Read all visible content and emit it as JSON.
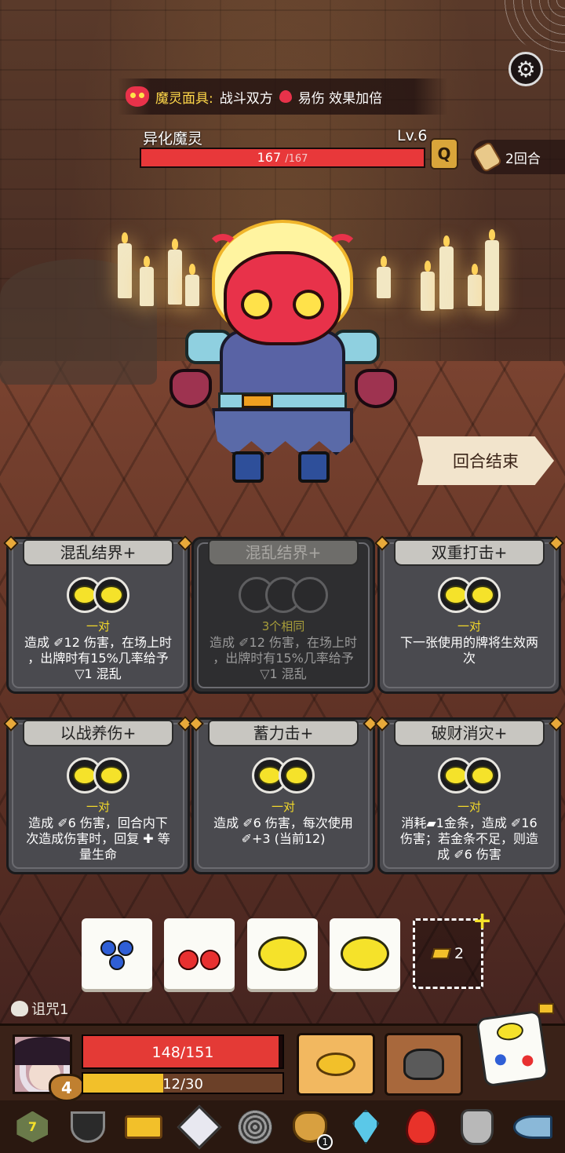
{
  "top": {
    "mask_label": "魔灵面具:",
    "mask_effect_a": "战斗双方",
    "mask_effect_b": "易伤 效果加倍"
  },
  "enemy": {
    "name": "异化魔灵",
    "level": "Lv.6",
    "hp_current": "167",
    "hp_max": "/167",
    "hp_fraction": 1.0
  },
  "turn": {
    "label": "2回合"
  },
  "end_turn_label": "回合结束",
  "cards": [
    {
      "title": "混乱结界+",
      "requirement": "一对",
      "desc_lines": [
        "造成 ✐12 伤害，在场上时",
        "，出牌时有15%几率给予",
        "▽1 混乱"
      ],
      "disabled": false
    },
    {
      "title": "混乱结界+",
      "requirement": "3个相同",
      "desc_lines": [
        "造成 ✐12 伤害，在场上时",
        "，出牌时有15%几率给予",
        "▽1 混乱"
      ],
      "disabled": true
    },
    {
      "title": "双重打击+",
      "requirement": "一对",
      "desc_lines": [
        "下一张使用的牌将生效两",
        "次"
      ],
      "disabled": false
    },
    {
      "title": "以战养伤+",
      "requirement": "一对",
      "desc_lines": [
        "造成 ✐6 伤害，回合内下",
        "次造成伤害时，回复 ✚ 等",
        "量生命"
      ],
      "disabled": false
    },
    {
      "title": "蓄力击+",
      "requirement": "一对",
      "desc_lines": [
        "造成 ✐6 伤害，每次使用",
        "✐+3 (当前12)"
      ],
      "disabled": false
    },
    {
      "title": "破财消灾+",
      "requirement": "一对",
      "desc_lines": [
        "消耗▰1金条，造成 ✐16",
        "伤害；若金条不足，则造",
        "成 ✐6 伤害"
      ],
      "disabled": false
    }
  ],
  "dice_pool": [
    "blueberry",
    "cherry",
    "lemon",
    "lemon"
  ],
  "gold_slot": {
    "count": "2"
  },
  "curse": {
    "label": "诅咒1"
  },
  "player": {
    "gold": "4",
    "hp_text": "148/151",
    "hp_fraction": 0.98,
    "xp_text": "12/30",
    "xp_fraction": 0.4
  },
  "relic_bar": {
    "items": [
      "d20-icon",
      "collar-icon",
      "treasure-chest-icon",
      "cube-icon",
      "spiral-icon",
      "gold-bag-icon",
      "ice-gem-icon",
      "fire-icon",
      "shield-icon",
      "horn-icon"
    ],
    "bag_badge": "1",
    "d20_face": "7"
  },
  "colors": {
    "accent_yellow": "#f2d92a",
    "hp_red": "#e8383a",
    "card_gray": "#4a4a4f"
  }
}
